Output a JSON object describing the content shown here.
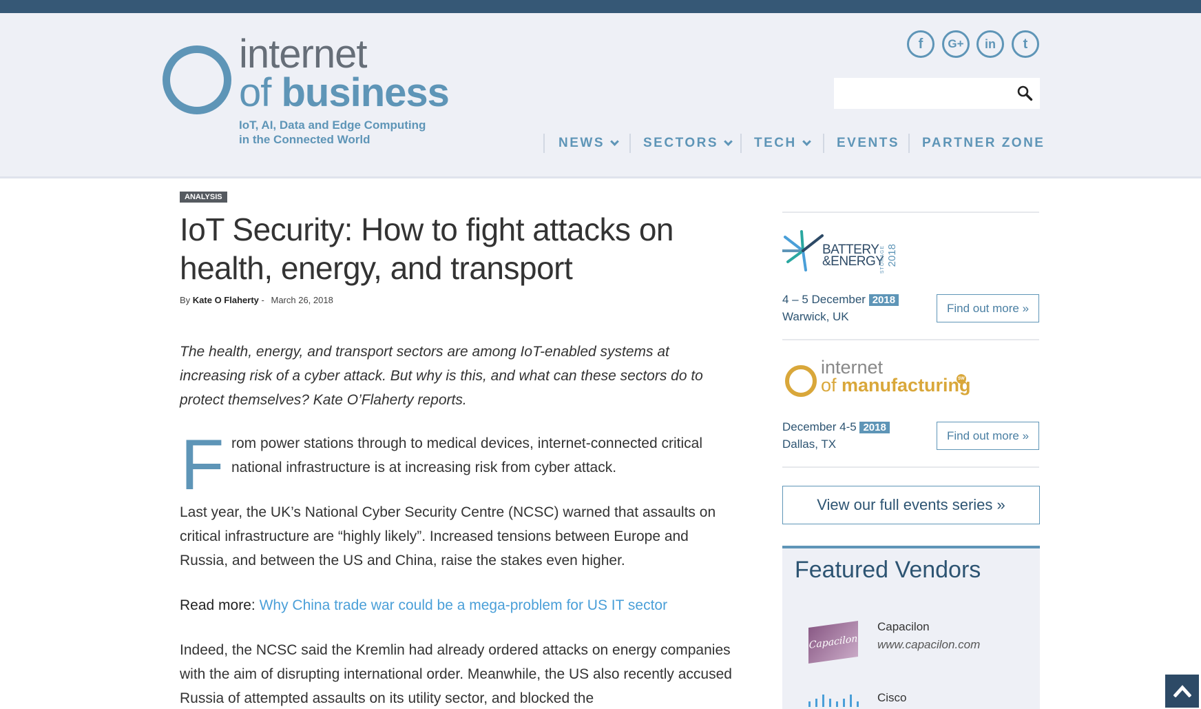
{
  "site": {
    "logo_line1": "internet",
    "logo_of": "of ",
    "logo_business": "business",
    "tagline_1": "IoT, AI, Data and Edge Computing",
    "tagline_2": "in the Connected World"
  },
  "social": [
    {
      "icon": "facebook-icon",
      "glyph": "f"
    },
    {
      "icon": "google-plus-icon",
      "glyph": "G+"
    },
    {
      "icon": "linkedin-icon",
      "glyph": "in"
    },
    {
      "icon": "twitter-icon",
      "glyph": "t"
    }
  ],
  "search": {
    "placeholder": "",
    "value": ""
  },
  "nav": {
    "news": "NEWS",
    "sectors": "SECTORS",
    "tech": "TECH",
    "events": "EVENTS",
    "partner_zone": "PARTNER ZONE"
  },
  "article": {
    "badge": "ANALYSIS",
    "title": "IoT Security: How to fight attacks on health, energy, and transport",
    "by": "By",
    "author": "Kate O Flaherty",
    "date_sep": "-",
    "date": "March 26, 2018",
    "lead": "The health, energy, and transport sectors are among IoT-enabled systems at increasing risk of a cyber attack. But why is this, and what can these sectors do to protect themselves? Kate O’Flaherty reports.",
    "dropcap": "F",
    "p1": "rom power stations through to medical devices, internet-connected critical national infrastructure is at increasing risk from cyber attack.",
    "p2": "Last year, the UK’s National Cyber Security Centre (NCSC) warned that assaults on critical infrastructure are “highly likely”. Increased tensions between Europe and Russia, and between the US and China, raise the stakes even higher.",
    "read_more_label": "Read more:",
    "read_more_link": "Why China trade war could be a mega-problem for US IT sector",
    "p3": "Indeed, the NCSC said the Kremlin had already ordered attacks on energy companies with the aim of disrupting international order. Meanwhile, the US also recently accused Russia of attempted assaults on its utility sector, and blocked the"
  },
  "sidebar": {
    "event1": {
      "logo_text_1": "BATTERY",
      "logo_text_2": "&ENERGY",
      "logo_side": "STORAGE",
      "logo_year": "2018",
      "date": "4 – 5 December",
      "year": "2018",
      "location": "Warwick, UK",
      "cta": "Find out more »"
    },
    "event2": {
      "logo_line1": "internet",
      "logo_of": "of ",
      "logo_manufacturing": "manufacturing",
      "logo_badge": "SW",
      "date": "December 4-5",
      "year": "2018",
      "location": "Dallas, TX",
      "cta": "Find out more »"
    },
    "series_cta": "View our full events series »",
    "vendors_title": "Featured Vendors",
    "vendors": [
      {
        "logo_text": "Capacilon",
        "name": "Capacilon",
        "url": "www.capacilon.com"
      },
      {
        "name": "Cisco"
      }
    ]
  },
  "colors": {
    "brand_blue": "#5e95b7",
    "top_bar": "#365876",
    "header_bg": "#eef0f6",
    "link": "#4a9fd8",
    "gold": "#d9a73a"
  }
}
